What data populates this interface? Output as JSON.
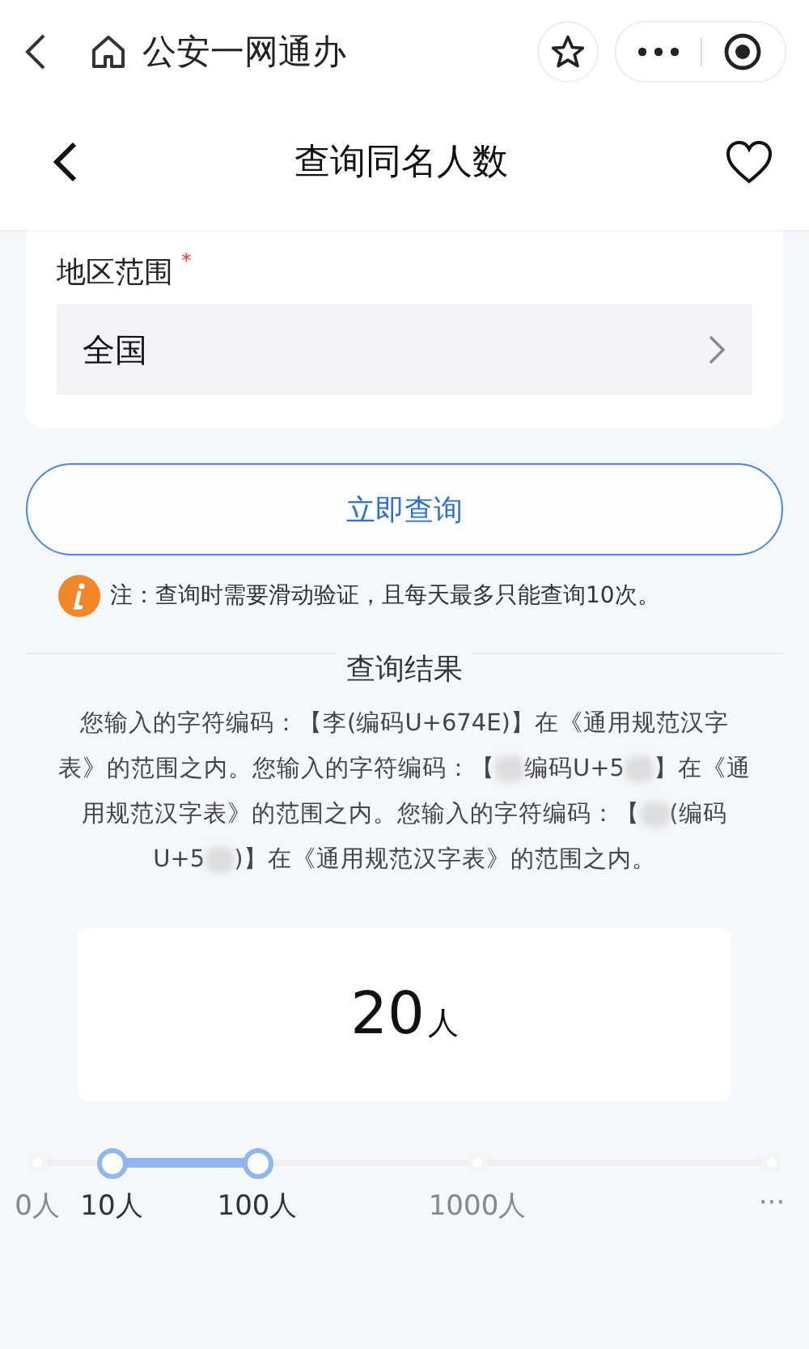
{
  "mini_program_bar": {
    "title": "公安一网通办"
  },
  "header": {
    "title": "查询同名人数"
  },
  "form": {
    "label": "地区范围",
    "required_mark": "*",
    "region": "全国"
  },
  "query_button": "立即查询",
  "note": "注：查询时需要滑动验证，且每天最多只能查询10次。",
  "result": {
    "heading": "查询结果",
    "segments": [
      {
        "kind": "text",
        "text": "您输入的字符编码：【李(编码U+674E)】在《通用规范汉字表》的范围之内。您输入的字符编码：【"
      },
      {
        "kind": "blur"
      },
      {
        "kind": "text",
        "text": "编码U+5"
      },
      {
        "kind": "blur"
      },
      {
        "kind": "text",
        "text": "】在《通用规范汉字表》的范围之内。您输入的字符编码：【"
      },
      {
        "kind": "blur"
      },
      {
        "kind": "text",
        "text": "(编码U+5"
      },
      {
        "kind": "blur"
      },
      {
        "kind": "text",
        "text": ")】在《通用规范汉字表》的范围之内。"
      }
    ],
    "count": "20",
    "unit": "人"
  },
  "range": {
    "ticks": [
      {
        "label": "0人",
        "selected": false
      },
      {
        "label": "10人",
        "selected": true
      },
      {
        "label": "100人",
        "selected": true
      },
      {
        "label": "1000人",
        "selected": false
      },
      {
        "label": "···",
        "selected": false
      }
    ]
  }
}
